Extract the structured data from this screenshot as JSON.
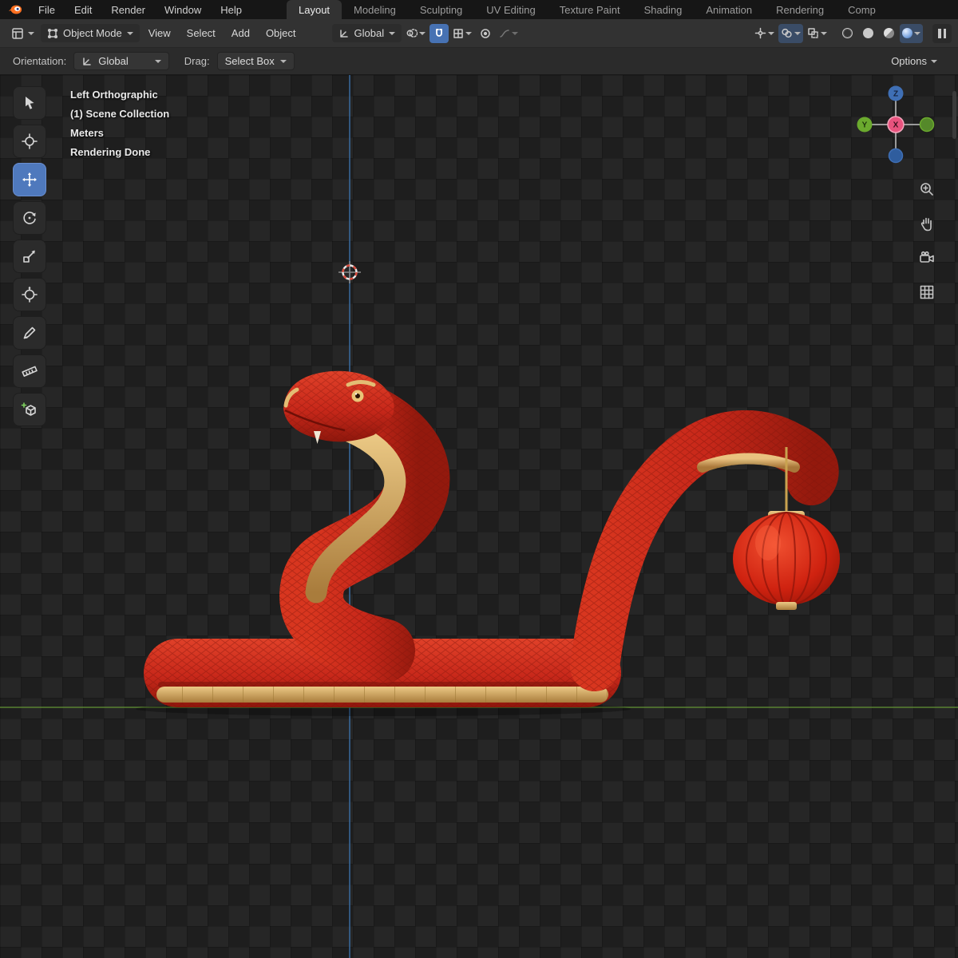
{
  "topbar": {
    "menus": [
      "File",
      "Edit",
      "Render",
      "Window",
      "Help"
    ],
    "tabs": [
      "Layout",
      "Modeling",
      "Sculpting",
      "UV Editing",
      "Texture Paint",
      "Shading",
      "Animation",
      "Rendering",
      "Comp"
    ]
  },
  "header": {
    "mode": "Object Mode",
    "menus": [
      "View",
      "Select",
      "Add",
      "Object"
    ],
    "orientation": "Global"
  },
  "toolsettings": {
    "orientation_label": "Orientation:",
    "orientation_value": "Global",
    "drag_label": "Drag:",
    "drag_value": "Select Box",
    "options": "Options"
  },
  "viewport": {
    "overlay": [
      "Left Orthographic",
      "(1) Scene Collection",
      "Meters",
      "Rendering Done"
    ],
    "gizmo": {
      "x": "X",
      "y": "Y",
      "z": "Z"
    }
  },
  "colors": {
    "accent_blue": "#4772b3",
    "axis_z_line": "#3a6ea5",
    "axis_y_line": "#5f8c33",
    "cursor_red": "#d84a3c",
    "snake_red": "#c8281a",
    "snake_gold": "#d7af63",
    "lantern_red": "#c21d0e"
  }
}
